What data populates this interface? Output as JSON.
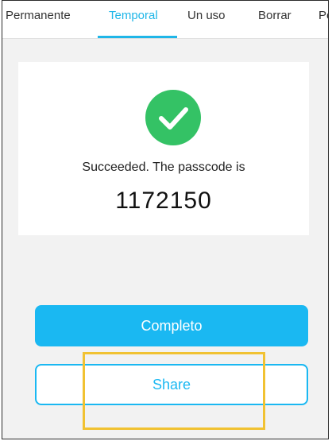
{
  "tabs": [
    {
      "label": "Permanente",
      "active": false
    },
    {
      "label": "Temporal",
      "active": true
    },
    {
      "label": "Un uso",
      "active": false
    },
    {
      "label": "Borrar",
      "active": false
    },
    {
      "label": "Pe",
      "active": false
    }
  ],
  "result": {
    "message": "Succeeded. The passcode is",
    "passcode": "1172150",
    "icon": "check-circle-icon"
  },
  "buttons": {
    "complete_label": "Completo",
    "share_label": "Share"
  },
  "colors": {
    "accent": "#1ab8f2",
    "success": "#34c265",
    "highlight": "#f1c232",
    "background": "#f2f2f2"
  }
}
